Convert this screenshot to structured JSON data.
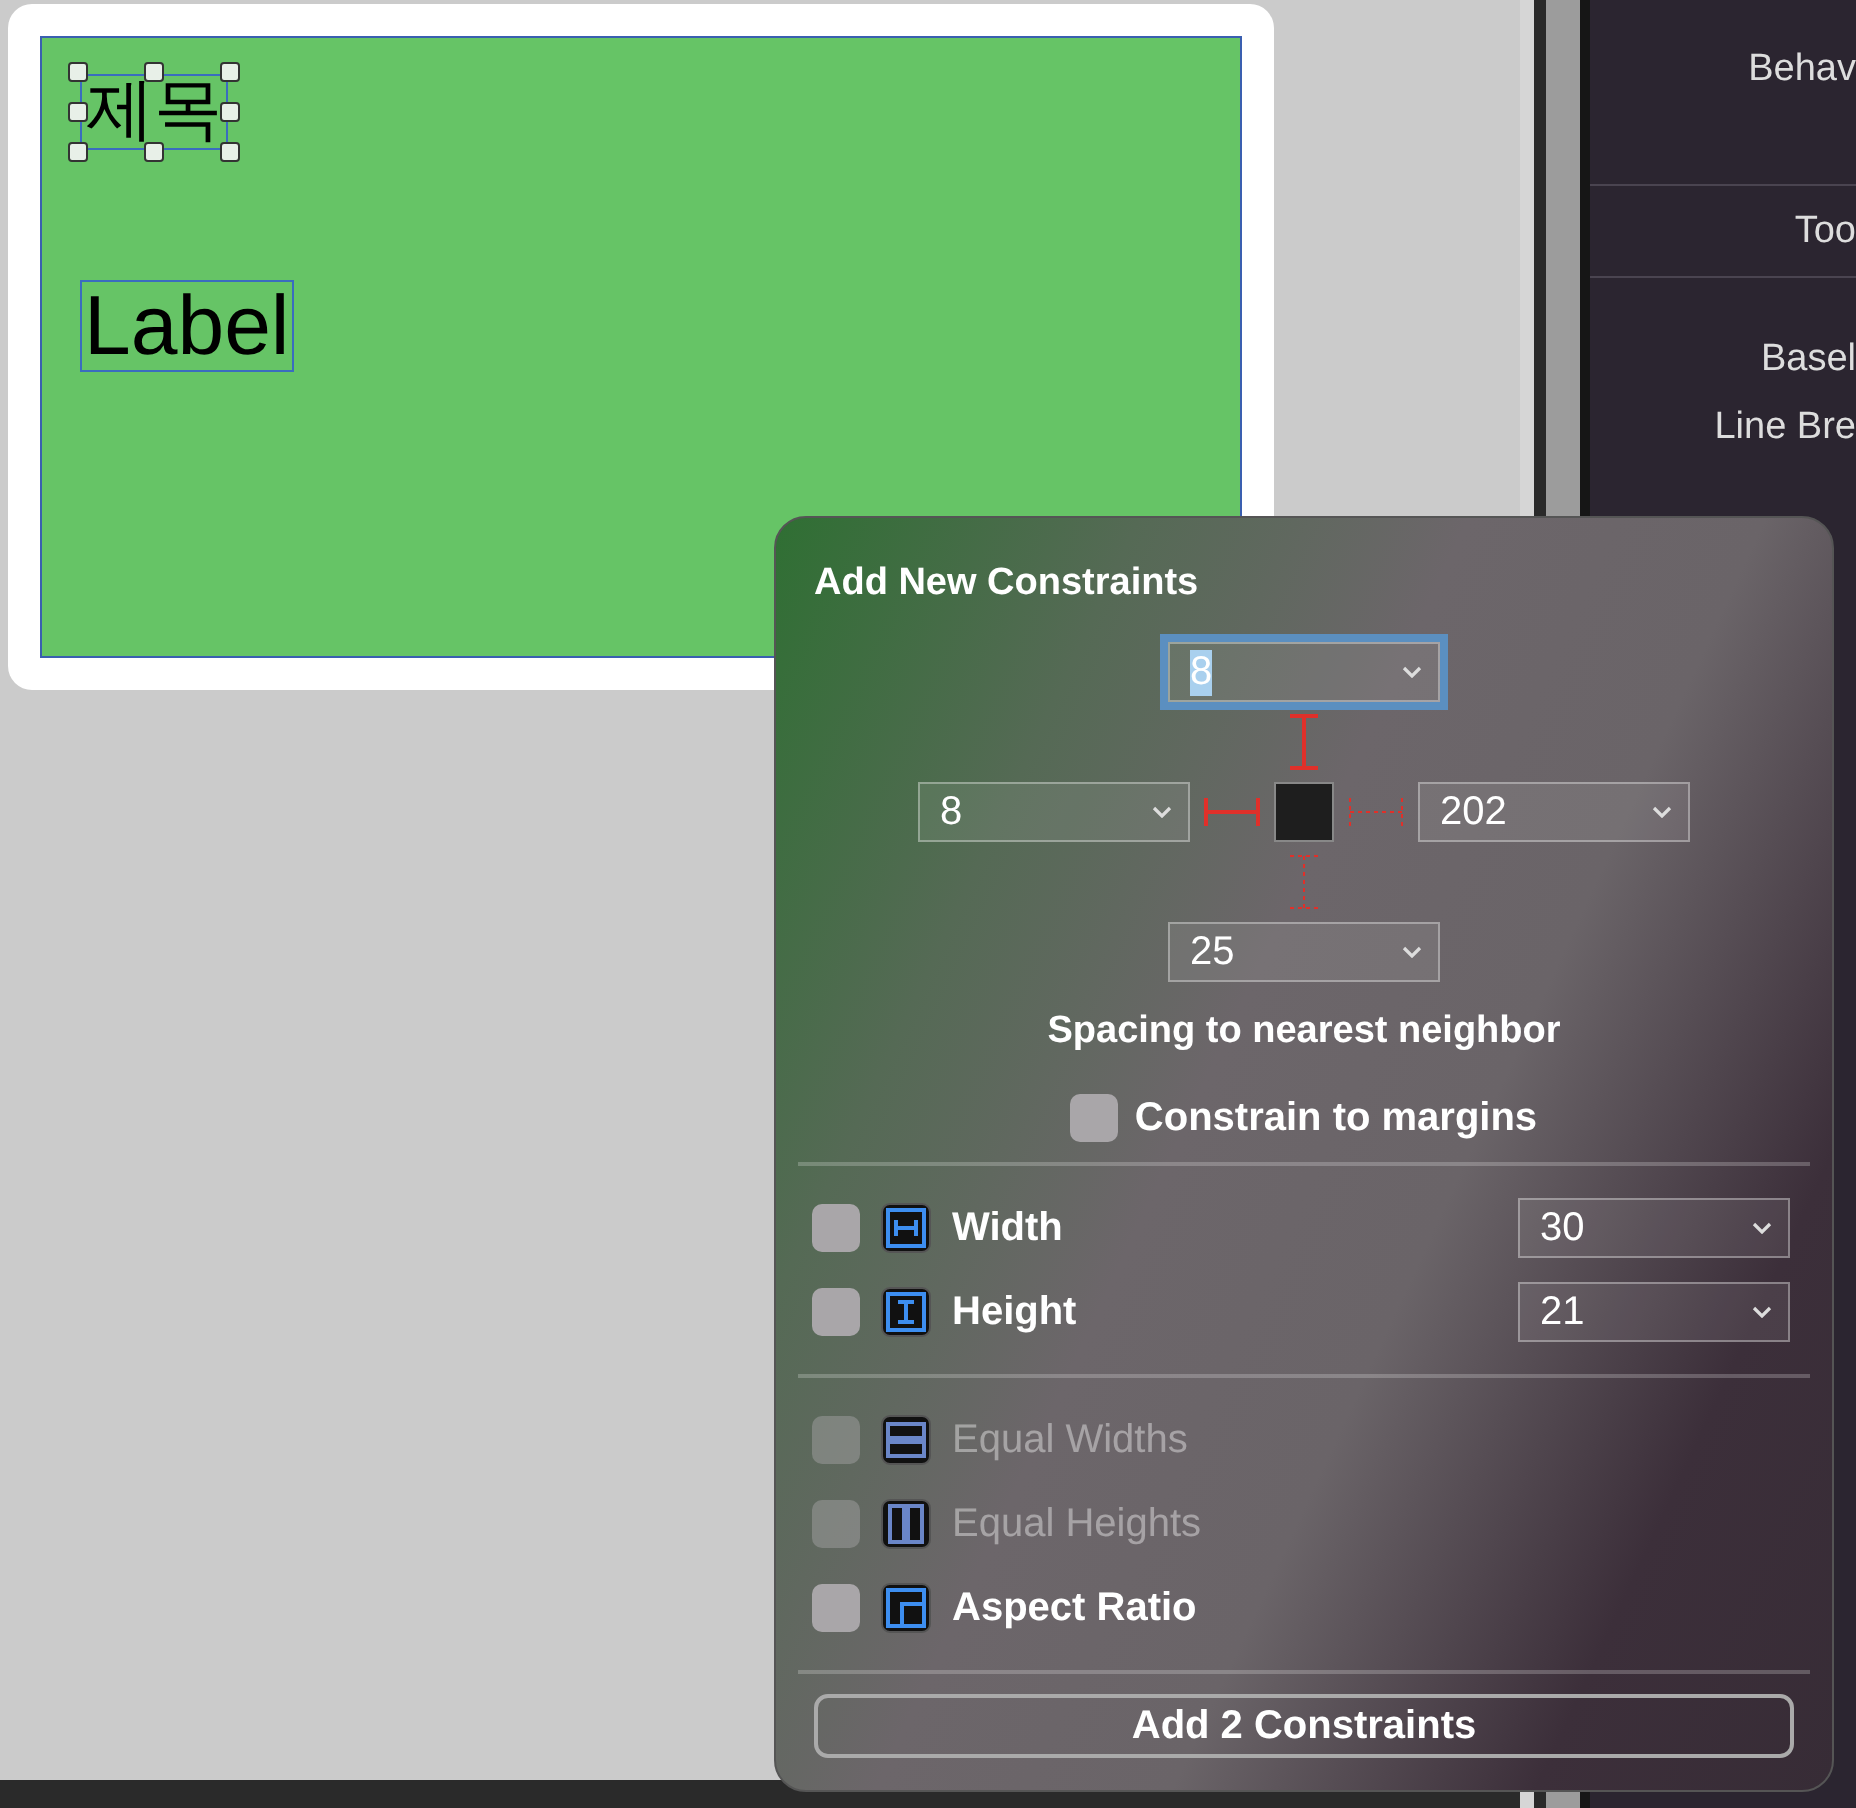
{
  "canvas": {
    "items": [
      {
        "text": "제목",
        "selected": true
      },
      {
        "text": "Label",
        "selected": false
      }
    ]
  },
  "inspector": {
    "labels": [
      "Behav",
      "Too",
      "Basel",
      "Line Bre"
    ]
  },
  "popover": {
    "title": "Add New Constraints",
    "spacing": {
      "top": {
        "value": "8",
        "focused": true,
        "pinned": true
      },
      "left": {
        "value": "8",
        "focused": false,
        "pinned": true
      },
      "right": {
        "value": "202",
        "focused": false,
        "pinned": false
      },
      "bottom": {
        "value": "25",
        "focused": false,
        "pinned": false
      }
    },
    "spacing_caption": "Spacing to nearest neighbor",
    "constrain_to_margins": {
      "label": "Constrain to margins",
      "checked": false
    },
    "dimension_rows": [
      {
        "kind": "width",
        "label": "Width",
        "checked": false,
        "disabled": false,
        "value": "30"
      },
      {
        "kind": "height",
        "label": "Height",
        "checked": false,
        "disabled": false,
        "value": "21"
      }
    ],
    "relation_rows": [
      {
        "kind": "equal-widths",
        "label": "Equal Widths",
        "checked": false,
        "disabled": true
      },
      {
        "kind": "equal-heights",
        "label": "Equal Heights",
        "checked": false,
        "disabled": true
      },
      {
        "kind": "aspect-ratio",
        "label": "Aspect Ratio",
        "checked": false,
        "disabled": false
      }
    ],
    "button": "Add 2 Constraints"
  }
}
